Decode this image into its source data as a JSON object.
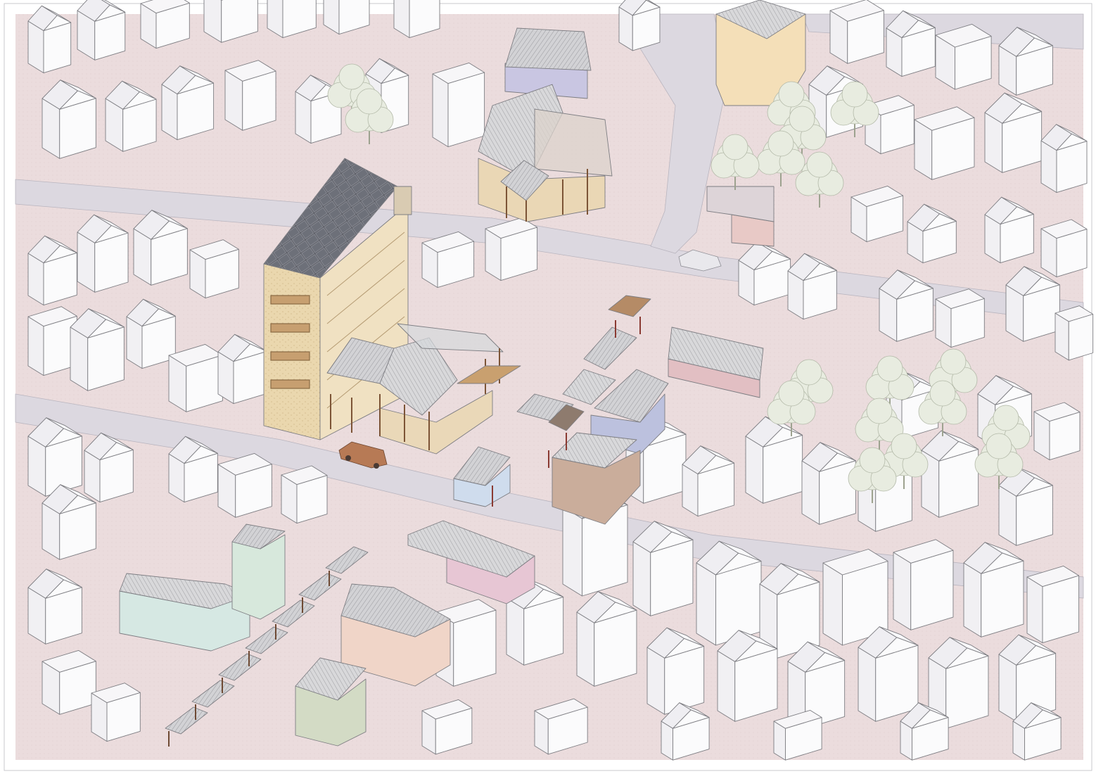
{
  "drawing": {
    "kind": "axonometric urban site drawing",
    "colors": {
      "paper": "#ffffff",
      "ground": "#ecdfe0",
      "road": "#dcd8e0",
      "massing_fill": "#f6f5f7",
      "massing_edge": "#7d7d82",
      "focus_timber": "#e9d6b0",
      "focus_frame": "#8a5a3a",
      "solar_panel": "#5e6068",
      "accent_blue": "#b8bddb",
      "accent_pink": "#e6c4c8",
      "accent_yellow": "#f4dfb8",
      "accent_green": "#d9e6db",
      "accent_brown": "#c9a994",
      "tree": "#e8ece0",
      "car": "#b77a55"
    },
    "elements": {
      "focus_building": "tall-timber-building-with-solar-roof",
      "courtyard_extension": "open-timber-courtyard-pavilion",
      "upper_pavilion": "timber-pavilion-with-gable-roof",
      "market_stalls": "covered-market-stall-row",
      "trees": "street-tree-cluster",
      "vehicle": "parked-pickup-truck"
    }
  }
}
